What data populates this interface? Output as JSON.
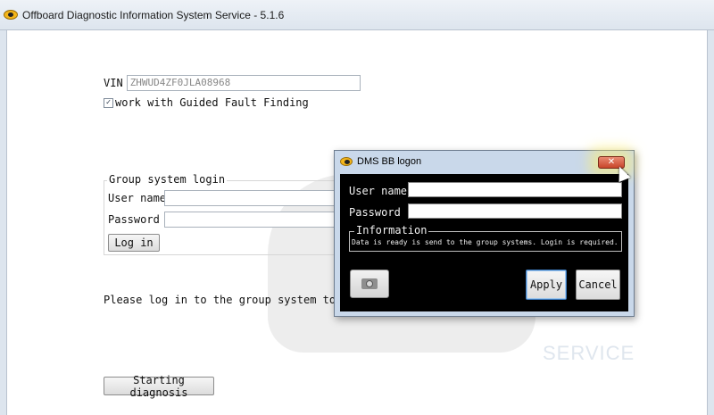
{
  "window": {
    "title": "Offboard Diagnostic Information System Service - 5.1.6"
  },
  "vin": {
    "label": "VIN",
    "value": "ZHWUD4ZF0JLA08968"
  },
  "guided_fault_finding": {
    "label": "work with Guided Fault Finding",
    "checked": true,
    "check_glyph": "✓"
  },
  "group_login": {
    "title": "Group system login",
    "user_label": "User name",
    "password_label": "Password",
    "login_button": "Log in"
  },
  "status_message": "Please log in to the group system to per",
  "starting_diagnosis_button": "Starting diagnosis",
  "watermark_text": "SERVICE",
  "dialog": {
    "title": "DMS BB logon",
    "close_glyph": "✕",
    "user_label": "User name",
    "password_label": "Password",
    "information_title": "Information",
    "information_text": "Data is ready is send to the group systems. Login is required.",
    "apply_button": "Apply",
    "cancel_button": "Cancel",
    "camera_icon": "camera-icon"
  },
  "colors": {
    "dialog_frame": "#c9d8ea",
    "dialog_body": "#000000",
    "close_button": "#c8452a",
    "app_icon": "#f3b51a"
  }
}
